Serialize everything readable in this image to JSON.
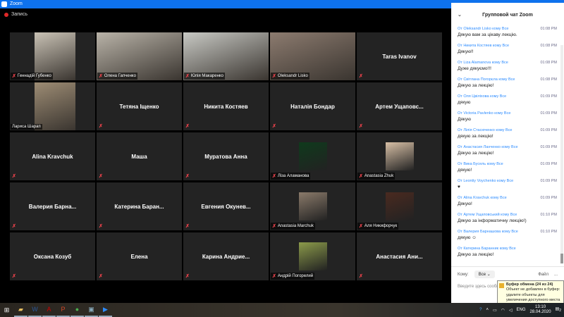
{
  "window": {
    "title": "Zoom",
    "recording": "Запись"
  },
  "tiles": [
    {
      "name": "Геннадій Губенко",
      "video": true,
      "bg": "#c9c2b5"
    },
    {
      "name": "Олена Гапченко",
      "video": true,
      "bg": "#b9b3a8"
    },
    {
      "name": "Юлія Макаренко",
      "video": true,
      "bg": "#c8c9c4",
      "active": true
    },
    {
      "name": "Oleksandr Lisko",
      "video": true,
      "bg": "#8c7b6f"
    },
    {
      "name": "Taras Ivanov"
    },
    {
      "name": "Лариса Шарап",
      "video": true,
      "bg": "#9d8c74",
      "nomic": true
    },
    {
      "name": "Тетяна Іщенко"
    },
    {
      "name": "Никита Костяев"
    },
    {
      "name": "Наталія Бондар"
    },
    {
      "name": "Артем  Ущаповс..."
    },
    {
      "name": "Alina Kravchuk"
    },
    {
      "name": "Маша"
    },
    {
      "name": "Муратова Анна"
    },
    {
      "name": "Ліза Аламанова",
      "thumb": "#0f3a1c"
    },
    {
      "name": "Anastasia Zhuk",
      "thumb": "#d8c0a6"
    },
    {
      "name": "Валерия  Барна..."
    },
    {
      "name": "Катерина  Баран..."
    },
    {
      "name": "Евгения  Окунев..."
    },
    {
      "name": "Anastasia Marchuk",
      "thumb": "#8a7a6a"
    },
    {
      "name": "Аля Никифорчук",
      "thumb": "#4a2a20"
    },
    {
      "name": "Оксана Козуб"
    },
    {
      "name": "Елена"
    },
    {
      "name": "Карина  Андрие..."
    },
    {
      "name": "Андрій Погорелий",
      "thumb": "#8b9a4a"
    },
    {
      "name": "Анастасия  Ани..."
    }
  ],
  "chat": {
    "title": "Групповой чат Zoom",
    "messages": [
      {
        "from": "От Oleksandr Lisko кому Все",
        "time": "01:08 PM",
        "text": "Дякую вам за цікаву лекцію."
      },
      {
        "from": "От Никита Костяев кому Все",
        "time": "01:08 PM",
        "text": "Дякую!!"
      },
      {
        "from": "От Liza Alamanova кому Все",
        "time": "01:08 PM",
        "text": "Дуже дякуємо!!!"
      },
      {
        "from": "От Світлана Погорєла кому Все",
        "time": "01:08 PM",
        "text": "Дякую за лекцію!"
      },
      {
        "from": "От Оля Цвіліхова кому Все",
        "time": "01:09 PM",
        "text": "дякую"
      },
      {
        "from": "От Victoria Pavlenko кому Все",
        "time": "01:09 PM",
        "text": "Дякую"
      },
      {
        "from": "От Лілія Стасюченко кому Все",
        "time": "01:09 PM",
        "text": "дякую за лекцію!"
      },
      {
        "from": "От Анастасия Ланченко кому Все",
        "time": "01:09 PM",
        "text": "Дякую за лекцію!"
      },
      {
        "from": "От Вика Бусель кому Все",
        "time": "01:09 PM",
        "text": "дякую!"
      },
      {
        "from": "От Leontiy Voychenko кому Все",
        "time": "01:09 PM",
        "text": "♥"
      },
      {
        "from": "От Alina Kravchuk кому Все",
        "time": "01:09 PM",
        "text": "Дякую!"
      },
      {
        "from": "От Артем Ущаповський кому Все",
        "time": "01:10 PM",
        "text": "Дякую за інформатичну лекцію!)"
      },
      {
        "from": "От Валерия Барнашова кому Все",
        "time": "01:10 PM",
        "text": "дякую ☺"
      },
      {
        "from": "От Катерина Баранник кому Все",
        "time": "",
        "text": "Дякую за лекцію!"
      }
    ],
    "to_label": "Кому:",
    "to_value": "Все",
    "file_label": "Файл",
    "more": "...",
    "input_placeholder": "Введите здесь сообщение..."
  },
  "tooltip": {
    "title": "Буфер обмена (24 из 24)",
    "body": "Объект не добавлен в буфер: удалите объекты для увеличения доступного места"
  },
  "taskbar": {
    "apps": [
      "file-explorer",
      "word",
      "acrobat",
      "powerpoint",
      "chrome",
      "photos",
      "zoom"
    ],
    "lang": "ENG",
    "time": "13:10",
    "date": "28.04.2020",
    "notifications": "2"
  }
}
